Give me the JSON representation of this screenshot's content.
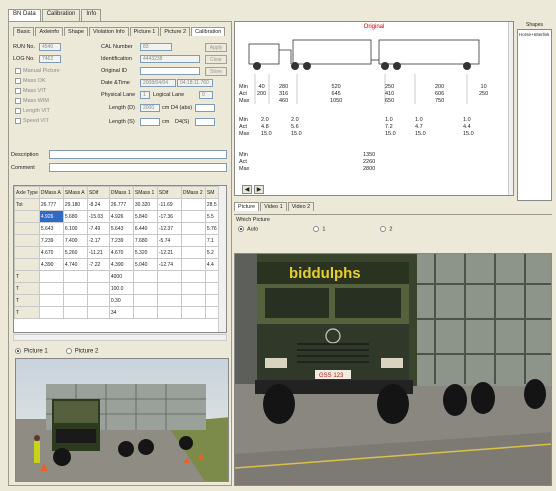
{
  "top_tabs": [
    "BN Data",
    "Calibration",
    "Info"
  ],
  "sub_tabs": [
    "Basic",
    "Axleinfo",
    "Shape",
    "Violation Info",
    "Picture 1",
    "Picture 2",
    "Calibration"
  ],
  "form": {
    "run_no_label": "RUN No.",
    "run_no_value": "4540",
    "cal_number_label": "CAL Number",
    "cal_number_value": "83",
    "log_no_label": "LOG No.",
    "log_no_value": "7462",
    "identification_label": "Identification",
    "identification_value": "4443238",
    "original_id_label": "Original ID",
    "date_time_label": "Date &Time",
    "date_value": "2008/04/04",
    "time_value": "04:18:11.760",
    "physical_lane_label": "Physical Lane",
    "logical_lane_label": "Logical Lane",
    "physical_lane_value": "1",
    "logical_lane_value": "0",
    "length_d_label": "Length (D)",
    "length_d_value": "2000",
    "length_d_unit": "cm",
    "d4_abs_label": "D4 (abs)",
    "length_s_label": "Length (S)",
    "length_s_unit": "cm",
    "d4_s_label": "D4(S)",
    "checks": [
      "Manual Picture",
      "Mass OK",
      "Mass VIT",
      "Mass WIM",
      "Length VIT",
      "Speed VIT"
    ],
    "buttons": [
      "Apply",
      "Clear",
      "Store"
    ],
    "description_label": "Description",
    "comment_label": "Comment"
  },
  "table": {
    "headers": [
      "Axle Type",
      "DMass A",
      "SMass A",
      "SDif",
      "DMass 1",
      "SMass 1",
      "SDif",
      "DMass 2",
      "SM"
    ],
    "rows": [
      [
        "Tot",
        "26.777",
        "29.180",
        "-8.24",
        "26.777",
        "30.320",
        "-11.69",
        "",
        "28.5"
      ],
      [
        "",
        "4.926",
        "5.680",
        "-15.03",
        "4.926",
        "5.840",
        "-17.36",
        "",
        "5.5"
      ],
      [
        "",
        "5.643",
        "6.100",
        "-7.49",
        "5.643",
        "6.440",
        "-12.37",
        "",
        "5.76"
      ],
      [
        "",
        "7.239",
        "7.400",
        "-2.17",
        "7.239",
        "7.680",
        "-5.74",
        "",
        "7.1"
      ],
      [
        "",
        "4.670",
        "5.260",
        "-11.21",
        "4.670",
        "5.320",
        "-12.21",
        "",
        "5.2"
      ],
      [
        "",
        "4.390",
        "4.740",
        "-7.22",
        "4.390",
        "5.040",
        "-12.74",
        "",
        "4.4"
      ],
      [
        "T",
        "",
        "",
        "",
        "4000",
        "",
        "",
        "",
        ""
      ],
      [
        "T",
        "",
        "",
        "",
        "100.0",
        "",
        "",
        "",
        ""
      ],
      [
        "T",
        "",
        "",
        "",
        "0.30",
        "",
        "",
        "",
        ""
      ],
      [
        "T",
        "",
        "",
        "",
        "34",
        "",
        "",
        "",
        ""
      ]
    ]
  },
  "picture_radios": [
    "Picture 1",
    "Picture 2"
  ],
  "diagram": {
    "title": "Original",
    "row_labels_1": [
      "Min",
      "Act",
      "Max"
    ],
    "row_labels_2": [
      "Min",
      "Act",
      "Max"
    ],
    "row_labels_3": [
      "Min",
      "Act",
      "Max"
    ],
    "spacing": [
      {
        "min": "40",
        "act": "",
        "max": "200"
      },
      {
        "min": "280",
        "act": "316",
        "max": "460"
      },
      {
        "min": "520",
        "act": "645",
        "max": "1050"
      },
      {
        "min": "250",
        "act": "410",
        "max": "650"
      },
      {
        "min": "200",
        "act": "606",
        "max": "750"
      },
      {
        "min": "10",
        "act": "",
        "max": "250"
      }
    ],
    "mass": [
      {
        "min": "2.0",
        "act": "4.8",
        "max": "15.0"
      },
      {
        "min": "2.0",
        "act": "5.6",
        "max": "15.0"
      },
      {
        "min": "1.0",
        "act": "7.2",
        "max": "15.0"
      },
      {
        "min": "1.0",
        "act": "4.7",
        "max": "15.0"
      },
      {
        "min": "1.0",
        "act": "4.4",
        "max": "15.0"
      }
    ],
    "total": {
      "min": "1350",
      "act": "2260",
      "max": "2800"
    }
  },
  "shapes": {
    "title": "Shapes",
    "item": "Horse+Interlink"
  },
  "picture_tabs": [
    "Picture",
    "Video 1",
    "Video 2"
  ],
  "which_picture": {
    "label": "Which Picture",
    "options": [
      "Auto",
      "1",
      "2"
    ]
  },
  "photo": {
    "brand_text": "biddulphs",
    "plate": "GSS 123"
  },
  "colors": {
    "accent": "#316ac5",
    "title_red": "#d00000",
    "panel": "#ece9d8"
  }
}
